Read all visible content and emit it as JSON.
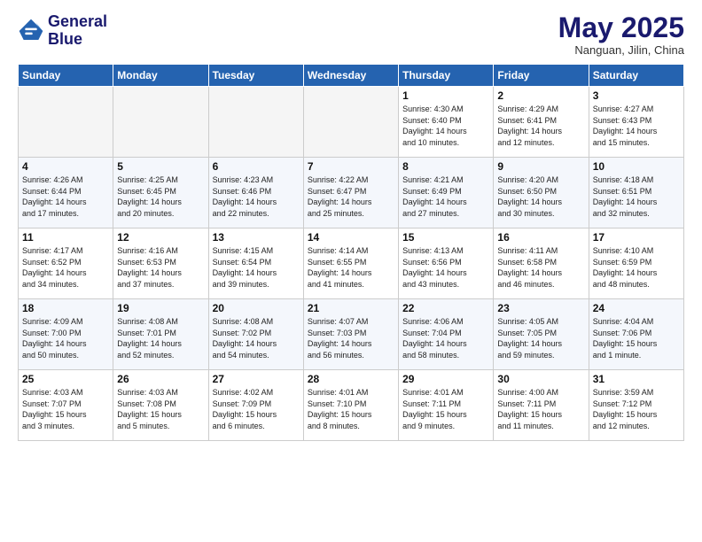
{
  "logo": {
    "line1": "General",
    "line2": "Blue"
  },
  "title": "May 2025",
  "subtitle": "Nanguan, Jilin, China",
  "days_header": [
    "Sunday",
    "Monday",
    "Tuesday",
    "Wednesday",
    "Thursday",
    "Friday",
    "Saturday"
  ],
  "weeks": [
    [
      {
        "num": "",
        "detail": ""
      },
      {
        "num": "",
        "detail": ""
      },
      {
        "num": "",
        "detail": ""
      },
      {
        "num": "",
        "detail": ""
      },
      {
        "num": "1",
        "detail": "Sunrise: 4:30 AM\nSunset: 6:40 PM\nDaylight: 14 hours\nand 10 minutes."
      },
      {
        "num": "2",
        "detail": "Sunrise: 4:29 AM\nSunset: 6:41 PM\nDaylight: 14 hours\nand 12 minutes."
      },
      {
        "num": "3",
        "detail": "Sunrise: 4:27 AM\nSunset: 6:43 PM\nDaylight: 14 hours\nand 15 minutes."
      }
    ],
    [
      {
        "num": "4",
        "detail": "Sunrise: 4:26 AM\nSunset: 6:44 PM\nDaylight: 14 hours\nand 17 minutes."
      },
      {
        "num": "5",
        "detail": "Sunrise: 4:25 AM\nSunset: 6:45 PM\nDaylight: 14 hours\nand 20 minutes."
      },
      {
        "num": "6",
        "detail": "Sunrise: 4:23 AM\nSunset: 6:46 PM\nDaylight: 14 hours\nand 22 minutes."
      },
      {
        "num": "7",
        "detail": "Sunrise: 4:22 AM\nSunset: 6:47 PM\nDaylight: 14 hours\nand 25 minutes."
      },
      {
        "num": "8",
        "detail": "Sunrise: 4:21 AM\nSunset: 6:49 PM\nDaylight: 14 hours\nand 27 minutes."
      },
      {
        "num": "9",
        "detail": "Sunrise: 4:20 AM\nSunset: 6:50 PM\nDaylight: 14 hours\nand 30 minutes."
      },
      {
        "num": "10",
        "detail": "Sunrise: 4:18 AM\nSunset: 6:51 PM\nDaylight: 14 hours\nand 32 minutes."
      }
    ],
    [
      {
        "num": "11",
        "detail": "Sunrise: 4:17 AM\nSunset: 6:52 PM\nDaylight: 14 hours\nand 34 minutes."
      },
      {
        "num": "12",
        "detail": "Sunrise: 4:16 AM\nSunset: 6:53 PM\nDaylight: 14 hours\nand 37 minutes."
      },
      {
        "num": "13",
        "detail": "Sunrise: 4:15 AM\nSunset: 6:54 PM\nDaylight: 14 hours\nand 39 minutes."
      },
      {
        "num": "14",
        "detail": "Sunrise: 4:14 AM\nSunset: 6:55 PM\nDaylight: 14 hours\nand 41 minutes."
      },
      {
        "num": "15",
        "detail": "Sunrise: 4:13 AM\nSunset: 6:56 PM\nDaylight: 14 hours\nand 43 minutes."
      },
      {
        "num": "16",
        "detail": "Sunrise: 4:11 AM\nSunset: 6:58 PM\nDaylight: 14 hours\nand 46 minutes."
      },
      {
        "num": "17",
        "detail": "Sunrise: 4:10 AM\nSunset: 6:59 PM\nDaylight: 14 hours\nand 48 minutes."
      }
    ],
    [
      {
        "num": "18",
        "detail": "Sunrise: 4:09 AM\nSunset: 7:00 PM\nDaylight: 14 hours\nand 50 minutes."
      },
      {
        "num": "19",
        "detail": "Sunrise: 4:08 AM\nSunset: 7:01 PM\nDaylight: 14 hours\nand 52 minutes."
      },
      {
        "num": "20",
        "detail": "Sunrise: 4:08 AM\nSunset: 7:02 PM\nDaylight: 14 hours\nand 54 minutes."
      },
      {
        "num": "21",
        "detail": "Sunrise: 4:07 AM\nSunset: 7:03 PM\nDaylight: 14 hours\nand 56 minutes."
      },
      {
        "num": "22",
        "detail": "Sunrise: 4:06 AM\nSunset: 7:04 PM\nDaylight: 14 hours\nand 58 minutes."
      },
      {
        "num": "23",
        "detail": "Sunrise: 4:05 AM\nSunset: 7:05 PM\nDaylight: 14 hours\nand 59 minutes."
      },
      {
        "num": "24",
        "detail": "Sunrise: 4:04 AM\nSunset: 7:06 PM\nDaylight: 15 hours\nand 1 minute."
      }
    ],
    [
      {
        "num": "25",
        "detail": "Sunrise: 4:03 AM\nSunset: 7:07 PM\nDaylight: 15 hours\nand 3 minutes."
      },
      {
        "num": "26",
        "detail": "Sunrise: 4:03 AM\nSunset: 7:08 PM\nDaylight: 15 hours\nand 5 minutes."
      },
      {
        "num": "27",
        "detail": "Sunrise: 4:02 AM\nSunset: 7:09 PM\nDaylight: 15 hours\nand 6 minutes."
      },
      {
        "num": "28",
        "detail": "Sunrise: 4:01 AM\nSunset: 7:10 PM\nDaylight: 15 hours\nand 8 minutes."
      },
      {
        "num": "29",
        "detail": "Sunrise: 4:01 AM\nSunset: 7:11 PM\nDaylight: 15 hours\nand 9 minutes."
      },
      {
        "num": "30",
        "detail": "Sunrise: 4:00 AM\nSunset: 7:11 PM\nDaylight: 15 hours\nand 11 minutes."
      },
      {
        "num": "31",
        "detail": "Sunrise: 3:59 AM\nSunset: 7:12 PM\nDaylight: 15 hours\nand 12 minutes."
      }
    ]
  ]
}
